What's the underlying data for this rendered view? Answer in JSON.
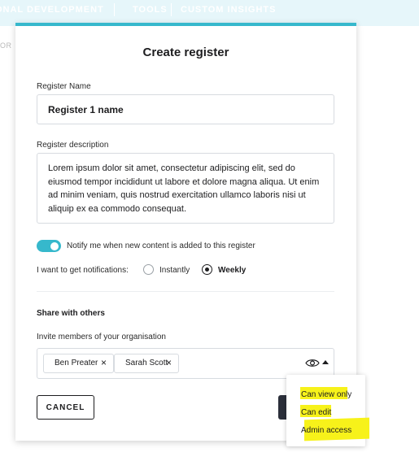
{
  "nav": {
    "items": [
      "ONAL DEVELOPMENT",
      "TOOLS",
      "CUSTOM INSIGHTS"
    ],
    "side_fragment": "OR"
  },
  "modal": {
    "title": "Create register",
    "accent_color": "#36b8cc",
    "register_name": {
      "label": "Register Name",
      "value": "Register 1 name"
    },
    "register_description": {
      "label": "Register description",
      "value": "Lorem ipsum dolor sit amet, consectetur adipiscing elit, sed do eiusmod tempor incididunt ut labore et dolore magna aliqua. Ut enim ad minim veniam, quis nostrud exercitation ullamco laboris nisi ut aliquip ex ea commodo consequat."
    },
    "notify": {
      "label": "Notify me when new content is added to this register",
      "enabled": true
    },
    "notifications": {
      "label": "I want to get notifications:",
      "options": [
        "Instantly",
        "Weekly"
      ],
      "selected": "Weekly"
    },
    "share": {
      "title": "Share with others",
      "invite_label": "Invite members of your organisation",
      "members": [
        "Ben Preater",
        "Sarah Scott"
      ],
      "remove_icon": "close-icon",
      "visibility_icon": "eye-icon"
    },
    "buttons": {
      "cancel": "CANCEL"
    }
  },
  "permissions_dropdown": {
    "options": [
      "Can view only",
      "Can edit",
      "Admin access"
    ],
    "highlight_color": "#f7f21a"
  }
}
